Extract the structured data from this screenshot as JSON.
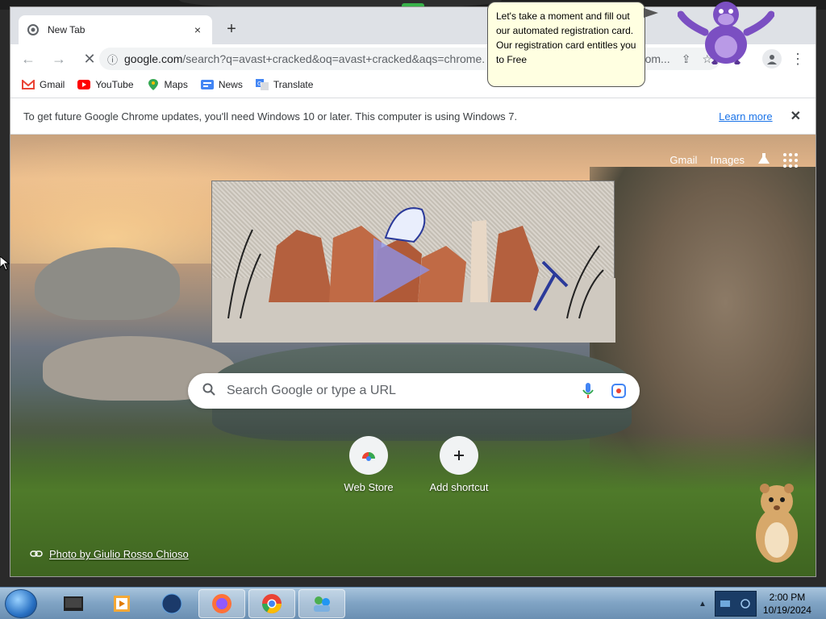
{
  "tab": {
    "title": "New Tab",
    "close": "×",
    "new_tab": "+"
  },
  "toolbar": {
    "back": "←",
    "forward": "→",
    "reload": "✕",
    "url_host": "google.com",
    "url_rest": "/search?q=avast+cracked&oq=avast+cracked&aqs=chrome.",
    "url_tail": "om...",
    "menu": "⋮"
  },
  "bookmarks": [
    {
      "label": "Gmail",
      "icon": "gmail-icon",
      "color": "#ea4335"
    },
    {
      "label": "YouTube",
      "icon": "youtube-icon",
      "color": "#ff0000"
    },
    {
      "label": "Maps",
      "icon": "maps-icon",
      "color": "#34a853"
    },
    {
      "label": "News",
      "icon": "news-icon",
      "color": "#4285f4"
    },
    {
      "label": "Translate",
      "icon": "translate-icon",
      "color": "#4285f4"
    }
  ],
  "infobar": {
    "message": "To get future Google Chrome updates, you'll need Windows 10 or later. This computer is using Windows 7.",
    "learn_more": "Learn more",
    "close": "✕"
  },
  "ntp": {
    "gmail_link": "Gmail",
    "images_link": "Images",
    "search_placeholder": "Search Google or type a URL",
    "shortcuts": [
      {
        "label": "Web Store",
        "icon": "web-store-icon"
      },
      {
        "label": "Add shortcut",
        "icon": "plus-icon"
      }
    ],
    "photo_credit": "Photo by Giulio Rosso Chioso"
  },
  "bubble": {
    "text": "Let's take a moment and fill out our automated registration card. Our registration card entitles you to Free"
  },
  "taskbar": {
    "time": "2:00 PM",
    "date": "10/19/2024"
  },
  "colors": {
    "link_blue": "#1a73e8",
    "bubble_bg": "#ffffe1",
    "taskbar_blue": "#7fa3c4"
  }
}
